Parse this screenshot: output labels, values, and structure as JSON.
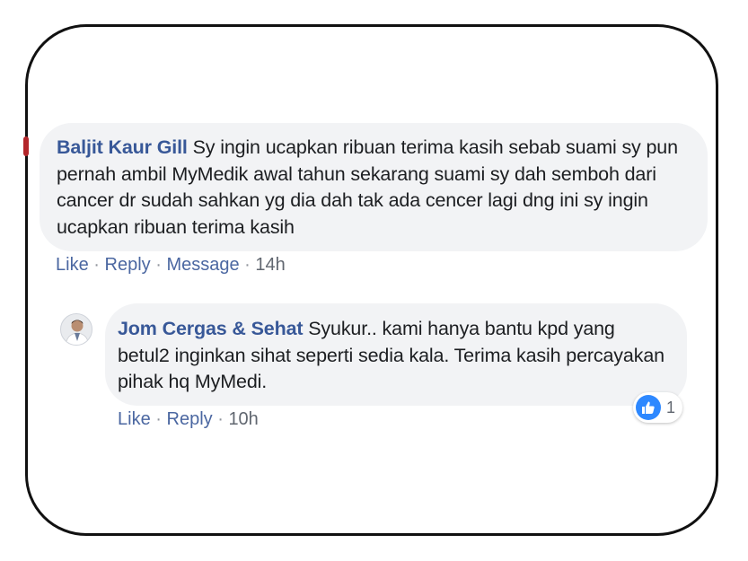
{
  "comment": {
    "author": "Baljit Kaur Gill",
    "body": "Sy ingin ucapkan ribuan terima kasih sebab suami sy pun pernah ambil MyMedik awal tahun sekarang suami sy dah semboh dari cancer dr sudah sahkan yg dia dah tak ada cencer lagi dng ini sy ingin ucapkan ribuan terima kasih",
    "actions": {
      "like": "Like",
      "reply": "Reply",
      "message": "Message",
      "separator": "·",
      "time": "14h"
    }
  },
  "reply": {
    "author": "Jom Cergas & Sehat",
    "body": "Syukur.. kami hanya bantu kpd yang betul2 inginkan sihat seperti sedia kala. Terima kasih percayakan pihak hq MyMedi.",
    "actions": {
      "like": "Like",
      "reply": "Reply",
      "separator": "·",
      "time": "10h"
    },
    "reaction": {
      "icon": "thumbs-up-icon",
      "count": "1",
      "color": "#2d88ff"
    }
  },
  "colors": {
    "name": "#385898",
    "link": "#4b67a1",
    "bubble": "#f2f3f5",
    "border": "#111111"
  }
}
